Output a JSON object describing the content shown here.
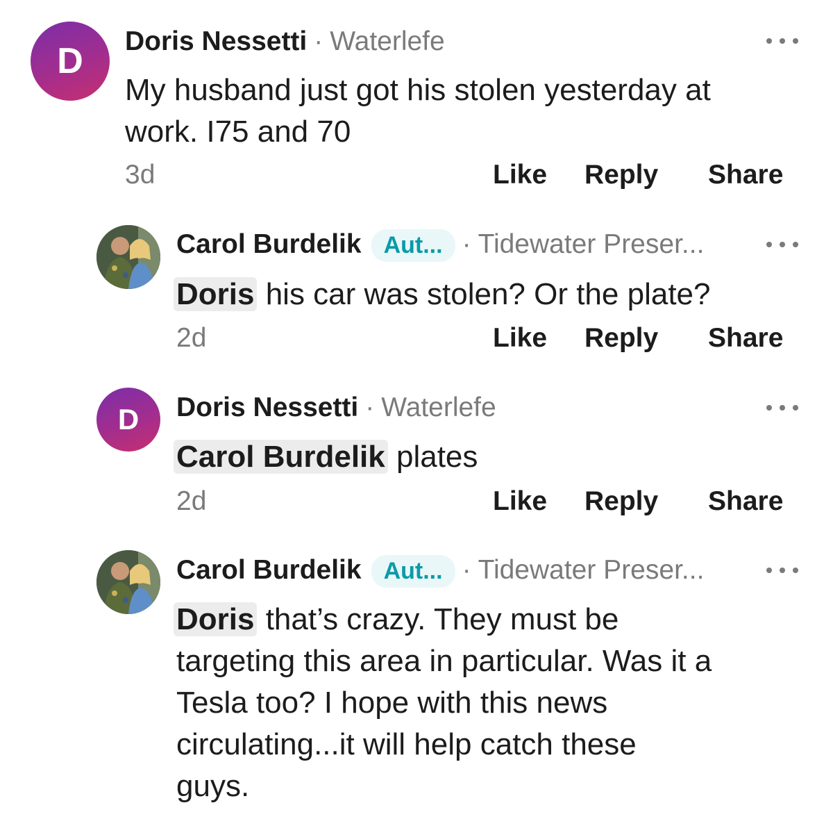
{
  "comments": [
    {
      "avatar_letter": "D",
      "author": "Doris Nessetti",
      "badge": "",
      "location": "Waterlefe",
      "mention": "",
      "text_lines": [
        "My husband just got his stolen yesterday at",
        "work.  I75 and 70"
      ],
      "time": "3d",
      "like": "Like",
      "reply": "Reply",
      "share": "Share"
    },
    {
      "avatar_letter": "",
      "author": "Carol Burdelik",
      "badge": "Aut...",
      "location": "Tidewater Preser...",
      "mention": "Doris",
      "text": " his car was stolen?  Or the plate?",
      "time": "2d",
      "like": "Like",
      "reply": "Reply",
      "share": "Share"
    },
    {
      "avatar_letter": "D",
      "author": "Doris Nessetti",
      "badge": "",
      "location": "Waterlefe",
      "mention": "Carol Burdelik",
      "text": " plates",
      "time": "2d",
      "like": "Like",
      "reply": "Reply",
      "share": "Share"
    },
    {
      "avatar_letter": "",
      "author": "Carol Burdelik",
      "badge": "Aut...",
      "location": "Tidewater Preser...",
      "mention": "Doris",
      "text_lines": [
        " that’s crazy. They must be",
        "targeting this area in particular. Was it a",
        "Tesla too?  I hope with this news",
        "circulating...it will help catch these",
        "guys."
      ]
    }
  ],
  "colors": {
    "accent_badge": "#0b9aa8",
    "avatar_gradient_start": "#7b2fa8",
    "avatar_gradient_end": "#c7306e",
    "muted_text": "#7a7a7a"
  },
  "icons": [
    "more-options-icon"
  ]
}
